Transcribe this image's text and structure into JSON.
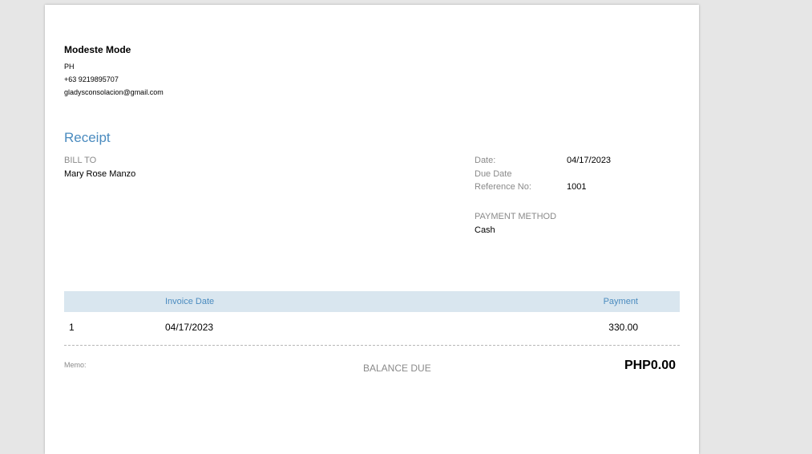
{
  "business": {
    "name": "Modeste Mode",
    "country": "PH",
    "phone": "+63 9219895707",
    "email": "gladysconsolacion@gmail.com"
  },
  "document": {
    "title": "Receipt"
  },
  "bill_to": {
    "label": "BILL TO",
    "name": "Mary Rose Manzo"
  },
  "details": {
    "date_label": "Date:",
    "date_value": "04/17/2023",
    "due_date_label": "Due Date",
    "reference_label": "Reference No:",
    "reference_value": "1001"
  },
  "payment_method": {
    "label": "PAYMENT METHOD",
    "value": "Cash"
  },
  "table": {
    "headers": {
      "col1": "",
      "invoice_date": "Invoice Date",
      "payment": "Payment"
    },
    "rows": [
      {
        "index": "1",
        "invoice_date": "04/17/2023",
        "payment": "330.00"
      }
    ]
  },
  "footer": {
    "memo_label": "Memo:",
    "balance_label": "BALANCE DUE",
    "balance_value": "PHP0.00"
  },
  "colors": {
    "accent": "#4a8bbf",
    "header_bg": "#d9e6ef",
    "muted": "#8a8a8a",
    "background": "#e6e6e6"
  }
}
